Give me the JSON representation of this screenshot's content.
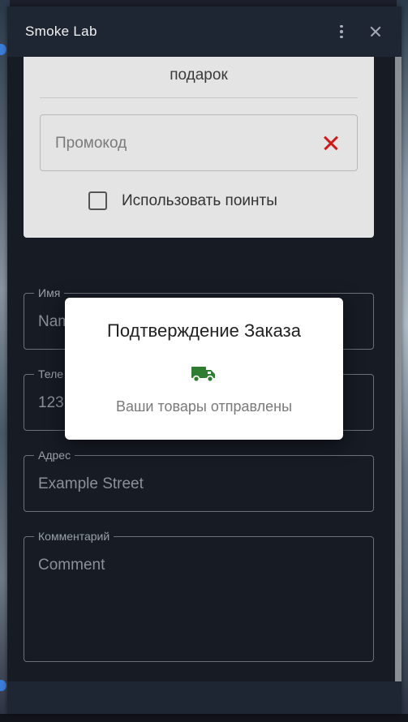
{
  "window": {
    "title": "Smoke Lab"
  },
  "cart_card": {
    "gift_text": "подарок",
    "promo": {
      "placeholder": "Промокод",
      "value": ""
    },
    "use_points_label": "Использовать поинты",
    "use_points_checked": false
  },
  "form": {
    "name": {
      "label": "Имя",
      "value": "Nam"
    },
    "phone": {
      "label": "Теле",
      "value": "123"
    },
    "address": {
      "label": "Адрес",
      "value": "Example Street"
    },
    "comment": {
      "label": "Комментарий",
      "value": "Comment"
    }
  },
  "dialog": {
    "title": "Подтверждение Заказа",
    "icon": "truck-icon",
    "icon_color": "#2e7d32",
    "message": "Ваши товары отправлены"
  },
  "colors": {
    "close_accent": "#d11a1a"
  }
}
